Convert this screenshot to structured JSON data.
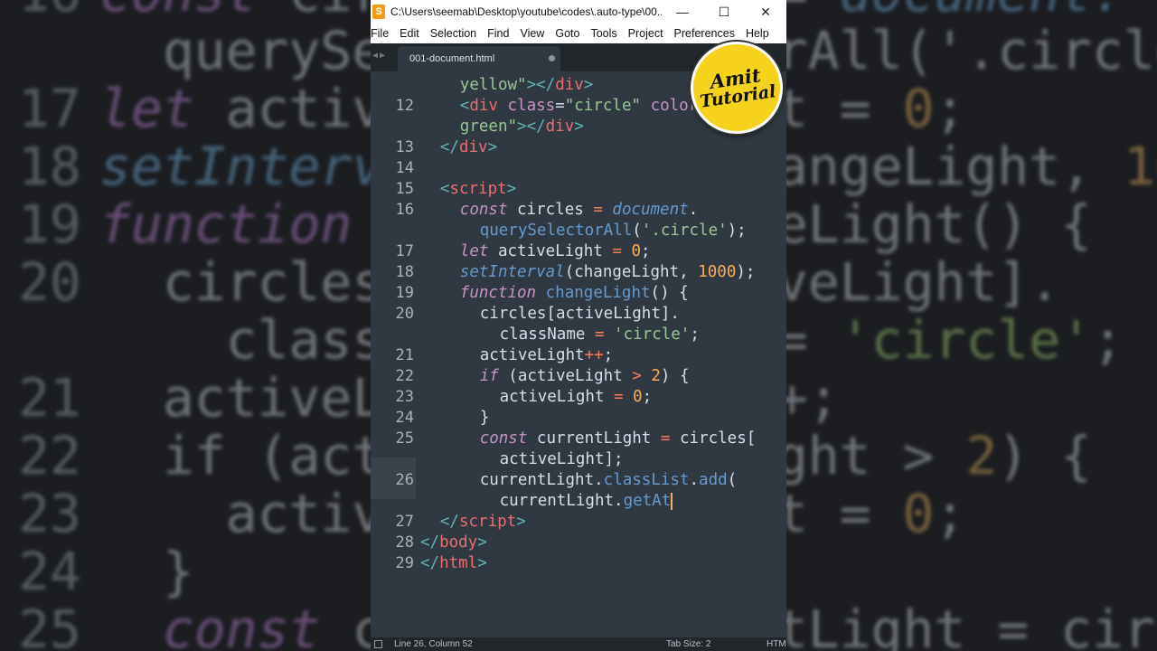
{
  "window": {
    "title": "C:\\Users\\seemab\\Desktop\\youtube\\codes\\.auto-type\\00...",
    "app_icon": "S",
    "controls": {
      "minimize": "—",
      "maximize": "☐",
      "close": "✕"
    }
  },
  "menu": [
    "File",
    "Edit",
    "Selection",
    "Find",
    "View",
    "Goto",
    "Tools",
    "Project",
    "Preferences",
    "Help"
  ],
  "tab": {
    "label": "001-document.html",
    "modified": true
  },
  "editor": {
    "current_line": 26,
    "lines": [
      {
        "num": "",
        "tokens": [
          [
            "t-str",
            "yellow\""
          ],
          [
            "t-br",
            ">"
          ],
          [
            "t-br",
            "</"
          ],
          [
            "t-tag",
            "div"
          ],
          [
            "t-br",
            ">"
          ]
        ]
      },
      {
        "num": "12",
        "tokens": [
          [
            "t-br",
            "<"
          ],
          [
            "t-tag",
            "div"
          ],
          [
            "t-pl",
            " "
          ],
          [
            "t-attr",
            "class"
          ],
          [
            "t-pl",
            "="
          ],
          [
            "t-str",
            "\"circle\""
          ],
          [
            "t-pl",
            " "
          ],
          [
            "t-attr",
            "color"
          ],
          [
            "t-pl",
            "="
          ]
        ]
      },
      {
        "num": "",
        "tokens": [
          [
            "t-str",
            "green\""
          ],
          [
            "t-br",
            ">"
          ],
          [
            "t-br",
            "</"
          ],
          [
            "t-tag",
            "div"
          ],
          [
            "t-br",
            ">"
          ]
        ]
      },
      {
        "num": "13",
        "tokens": [
          [
            "t-br",
            "</"
          ],
          [
            "t-tag",
            "div"
          ],
          [
            "t-br",
            ">"
          ]
        ]
      },
      {
        "num": "14",
        "tokens": []
      },
      {
        "num": "15",
        "tokens": [
          [
            "t-br",
            "<"
          ],
          [
            "t-tag",
            "script"
          ],
          [
            "t-br",
            ">"
          ]
        ]
      },
      {
        "num": "16",
        "tokens": [
          [
            "t-kw",
            "const"
          ],
          [
            "t-pl",
            " circles "
          ],
          [
            "t-op",
            "="
          ],
          [
            "t-pl",
            " "
          ],
          [
            "t-var",
            "document"
          ],
          [
            "t-pl",
            "."
          ]
        ]
      },
      {
        "num": "",
        "tokens": [
          [
            "t-fn",
            "querySelectorAll"
          ],
          [
            "t-pl",
            "("
          ],
          [
            "t-str",
            "'.circle'"
          ],
          [
            "t-pl",
            ");"
          ]
        ]
      },
      {
        "num": "17",
        "tokens": [
          [
            "t-kw",
            "let"
          ],
          [
            "t-pl",
            " activeLight "
          ],
          [
            "t-op",
            "="
          ],
          [
            "t-pl",
            " "
          ],
          [
            "t-num",
            "0"
          ],
          [
            "t-pl",
            ";"
          ]
        ]
      },
      {
        "num": "18",
        "tokens": [
          [
            "t-var",
            "setInterval"
          ],
          [
            "t-pl",
            "(changeLight, "
          ],
          [
            "t-num",
            "1000"
          ],
          [
            "t-pl",
            ");"
          ]
        ]
      },
      {
        "num": "19",
        "tokens": [
          [
            "t-kw",
            "function"
          ],
          [
            "t-pl",
            " "
          ],
          [
            "t-fn",
            "changeLight"
          ],
          [
            "t-pl",
            "() {"
          ]
        ]
      },
      {
        "num": "20",
        "tokens": [
          [
            "t-pl",
            "circles[activeLight]."
          ]
        ]
      },
      {
        "num": "",
        "tokens": [
          [
            "t-pl",
            "className "
          ],
          [
            "t-op",
            "="
          ],
          [
            "t-pl",
            " "
          ],
          [
            "t-str",
            "'circle'"
          ],
          [
            "t-pl",
            ";"
          ]
        ]
      },
      {
        "num": "21",
        "tokens": [
          [
            "t-pl",
            "activeLight"
          ],
          [
            "t-op",
            "++"
          ],
          [
            "t-pl",
            ";"
          ]
        ]
      },
      {
        "num": "22",
        "tokens": [
          [
            "t-kw",
            "if"
          ],
          [
            "t-pl",
            " (activeLight "
          ],
          [
            "t-op",
            ">"
          ],
          [
            "t-pl",
            " "
          ],
          [
            "t-num",
            "2"
          ],
          [
            "t-pl",
            ") {"
          ]
        ]
      },
      {
        "num": "23",
        "tokens": [
          [
            "t-pl",
            "activeLight "
          ],
          [
            "t-op",
            "="
          ],
          [
            "t-pl",
            " "
          ],
          [
            "t-num",
            "0"
          ],
          [
            "t-pl",
            ";"
          ]
        ]
      },
      {
        "num": "24",
        "tokens": [
          [
            "t-pl",
            "}"
          ]
        ]
      },
      {
        "num": "25",
        "tokens": [
          [
            "t-kw",
            "const"
          ],
          [
            "t-pl",
            " currentLight "
          ],
          [
            "t-op",
            "="
          ],
          [
            "t-pl",
            " circles["
          ]
        ]
      },
      {
        "num": "",
        "tokens": [
          [
            "t-pl",
            "activeLight];"
          ]
        ]
      },
      {
        "num": "26",
        "tokens": [
          [
            "t-pl",
            "currentLight."
          ],
          [
            "t-fn",
            "classList"
          ],
          [
            "t-pl",
            "."
          ],
          [
            "t-fn",
            "add"
          ],
          [
            "t-pl",
            "("
          ]
        ]
      },
      {
        "num": "",
        "tokens": [
          [
            "t-pl",
            "currentLight."
          ],
          [
            "t-fn",
            "getAt"
          ]
        ],
        "cursor": true
      },
      {
        "num": "27",
        "tokens": [
          [
            "t-br",
            "</"
          ],
          [
            "t-tag",
            "script"
          ],
          [
            "t-br",
            ">"
          ]
        ]
      },
      {
        "num": "28",
        "tokens": [
          [
            "t-br",
            "</"
          ],
          [
            "t-tag",
            "body"
          ],
          [
            "t-br",
            ">"
          ]
        ]
      },
      {
        "num": "29",
        "tokens": [
          [
            "t-br",
            "</"
          ],
          [
            "t-tag",
            "html"
          ],
          [
            "t-br",
            ">"
          ]
        ]
      }
    ]
  },
  "status": {
    "position": "Line 26, Column 52",
    "tab_size": "Tab Size: 2",
    "syntax": "HTML"
  },
  "logo": {
    "line1": "Amit",
    "line2": "Tutorial"
  },
  "background_left": [
    {
      "num": "16",
      "tokens": [
        [
          "kw",
          "const"
        ],
        [
          "tx",
          " circles = "
        ],
        [
          "fn",
          "document."
        ]
      ]
    },
    {
      "num": "",
      "tokens": [
        [
          "tx",
          "  querySelectorAll('.circle');"
        ]
      ]
    },
    {
      "num": "17",
      "tokens": [
        [
          "kw",
          "let"
        ],
        [
          "tx",
          " activeLight = "
        ],
        [
          "nm",
          "0"
        ],
        [
          "tx",
          ";"
        ]
      ]
    },
    {
      "num": "18",
      "tokens": [
        [
          "fn",
          "setInterval"
        ],
        [
          "tx",
          "(changeLight, "
        ],
        [
          "nm",
          "1000"
        ],
        [
          "tx",
          ");"
        ]
      ]
    },
    {
      "num": "19",
      "tokens": [
        [
          "kw",
          "function"
        ],
        [
          "tx",
          " changeLight() {"
        ]
      ]
    },
    {
      "num": "20",
      "tokens": [
        [
          "tx",
          "  circles[activeLight]."
        ]
      ]
    },
    {
      "num": "",
      "tokens": [
        [
          "tx",
          "    className = "
        ],
        [
          "st",
          "'circle'"
        ],
        [
          "tx",
          ";"
        ]
      ]
    },
    {
      "num": "21",
      "tokens": [
        [
          "tx",
          "  activeLight++;"
        ]
      ]
    },
    {
      "num": "22",
      "tokens": [
        [
          "tx",
          "  if (activeLight > "
        ],
        [
          "nm",
          "2"
        ],
        [
          "tx",
          ") {"
        ]
      ]
    },
    {
      "num": "23",
      "tokens": [
        [
          "tx",
          "    activeLight = "
        ],
        [
          "nm",
          "0"
        ],
        [
          "tx",
          ";"
        ]
      ]
    },
    {
      "num": "24",
      "tokens": [
        [
          "tx",
          "  }"
        ]
      ]
    },
    {
      "num": "25",
      "tokens": [
        [
          "kw",
          "  const"
        ],
        [
          "tx",
          " currentLight = circles["
        ]
      ]
    }
  ]
}
